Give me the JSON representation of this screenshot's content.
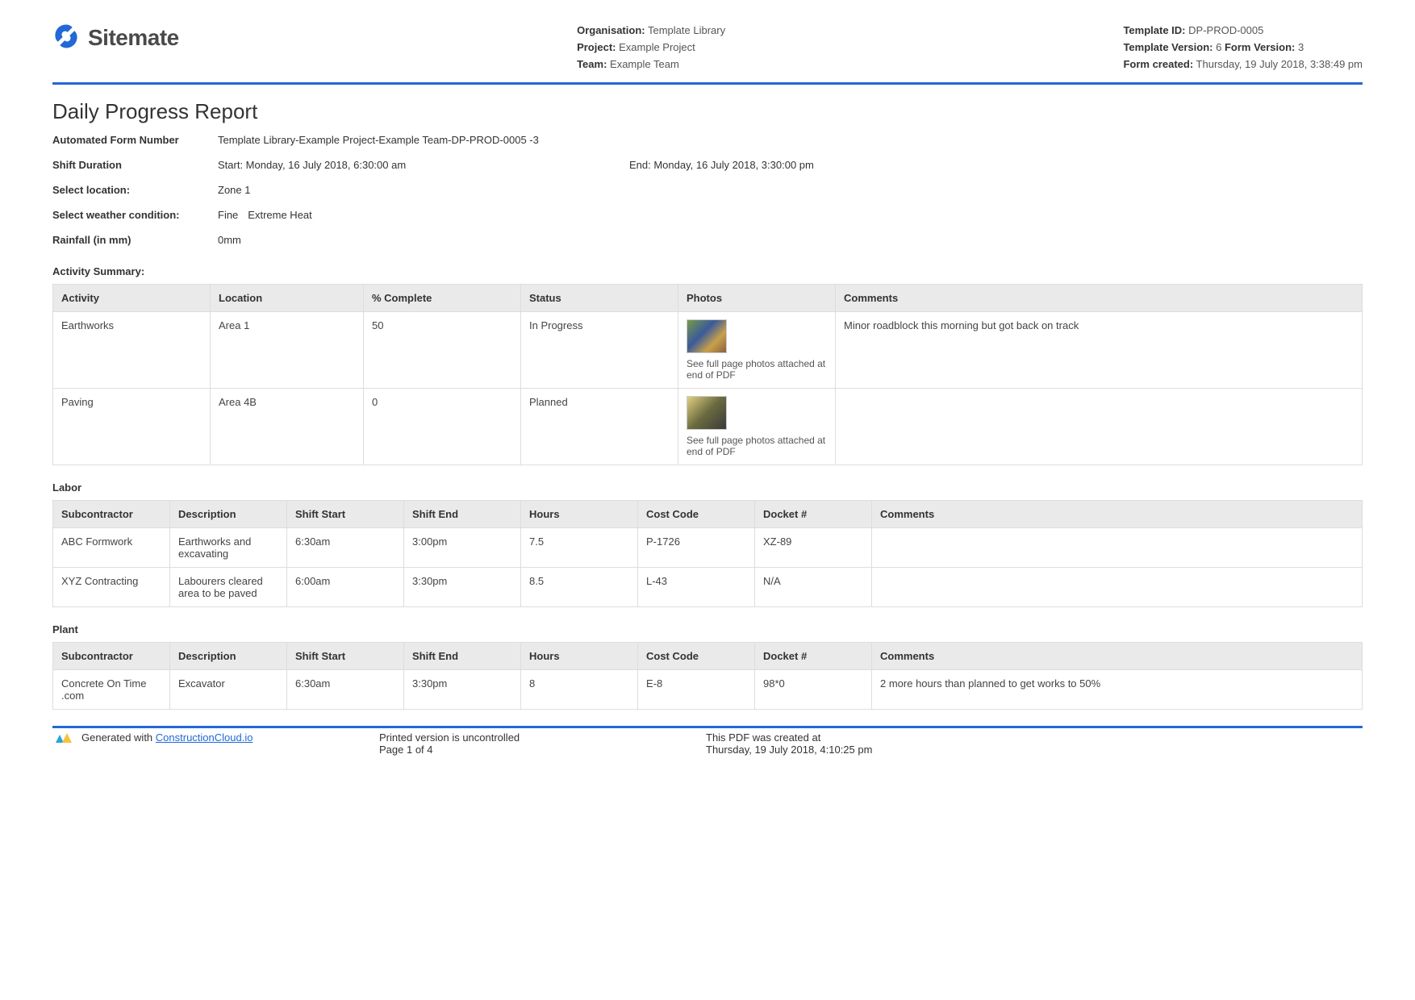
{
  "header": {
    "logo_text": "Sitemate",
    "org_label": "Organisation:",
    "org_value": "Template Library",
    "project_label": "Project:",
    "project_value": "Example Project",
    "team_label": "Team:",
    "team_value": "Example Team",
    "template_id_label": "Template ID:",
    "template_id_value": "DP-PROD-0005",
    "template_version_label": "Template Version:",
    "template_version_value": "6",
    "form_version_label": "Form Version:",
    "form_version_value": "3",
    "form_created_label": "Form created:",
    "form_created_value": "Thursday, 19 July 2018, 3:38:49 pm"
  },
  "title": "Daily Progress Report",
  "fields": {
    "auto_form_label": "Automated Form Number",
    "auto_form_value": "Template Library-Example Project-Example Team-DP-PROD-0005   -3",
    "shift_duration_label": "Shift Duration",
    "shift_start": "Start: Monday, 16 July 2018, 6:30:00 am",
    "shift_end": "End: Monday, 16 July 2018, 3:30:00 pm",
    "location_label": "Select location:",
    "location_value": "Zone 1",
    "weather_label": "Select weather condition:",
    "weather_value_1": "Fine",
    "weather_value_2": "Extreme Heat",
    "rainfall_label": "Rainfall (in mm)",
    "rainfall_value": "0mm"
  },
  "activity": {
    "title": "Activity Summary:",
    "headers": [
      "Activity",
      "Location",
      "% Complete",
      "Status",
      "Photos",
      "Comments"
    ],
    "photo_note": "See full page photos attached at end of PDF",
    "rows": [
      {
        "activity": "Earthworks",
        "location": "Area 1",
        "pct": "50",
        "status": "In Progress",
        "comments": "Minor roadblock this morning but got back on track"
      },
      {
        "activity": "Paving",
        "location": "Area 4B",
        "pct": "0",
        "status": "Planned",
        "comments": ""
      }
    ]
  },
  "labor": {
    "title": "Labor",
    "headers": [
      "Subcontractor",
      "Description",
      "Shift Start",
      "Shift End",
      "Hours",
      "Cost Code",
      "Docket #",
      "Comments"
    ],
    "rows": [
      {
        "sub": "ABC Formwork",
        "desc": "Earthworks and excavating",
        "start": "6:30am",
        "end": "3:00pm",
        "hours": "7.5",
        "cost": "P-1726",
        "docket": "XZ-89",
        "comments": ""
      },
      {
        "sub": "XYZ Contracting",
        "desc": "Labourers cleared area to be paved",
        "start": "6:00am",
        "end": "3:30pm",
        "hours": "8.5",
        "cost": "L-43",
        "docket": "N/A",
        "comments": ""
      }
    ]
  },
  "plant": {
    "title": "Plant",
    "headers": [
      "Subcontractor",
      "Description",
      "Shift Start",
      "Shift End",
      "Hours",
      "Cost Code",
      "Docket #",
      "Comments"
    ],
    "rows": [
      {
        "sub": "Concrete On Time .com",
        "desc": "Excavator",
        "start": "6:30am",
        "end": "3:30pm",
        "hours": "8",
        "cost": "E-8",
        "docket": "98*0",
        "comments": "2 more hours than planned to get works to 50%"
      }
    ]
  },
  "footer": {
    "generated_prefix": "Generated with ",
    "generated_link": "ConstructionCloud.io",
    "uncontrolled": "Printed version is uncontrolled",
    "page": "Page 1 of 4",
    "created_at_label": "This PDF was created at",
    "created_at_value": "Thursday, 19 July 2018, 4:10:25 pm"
  }
}
